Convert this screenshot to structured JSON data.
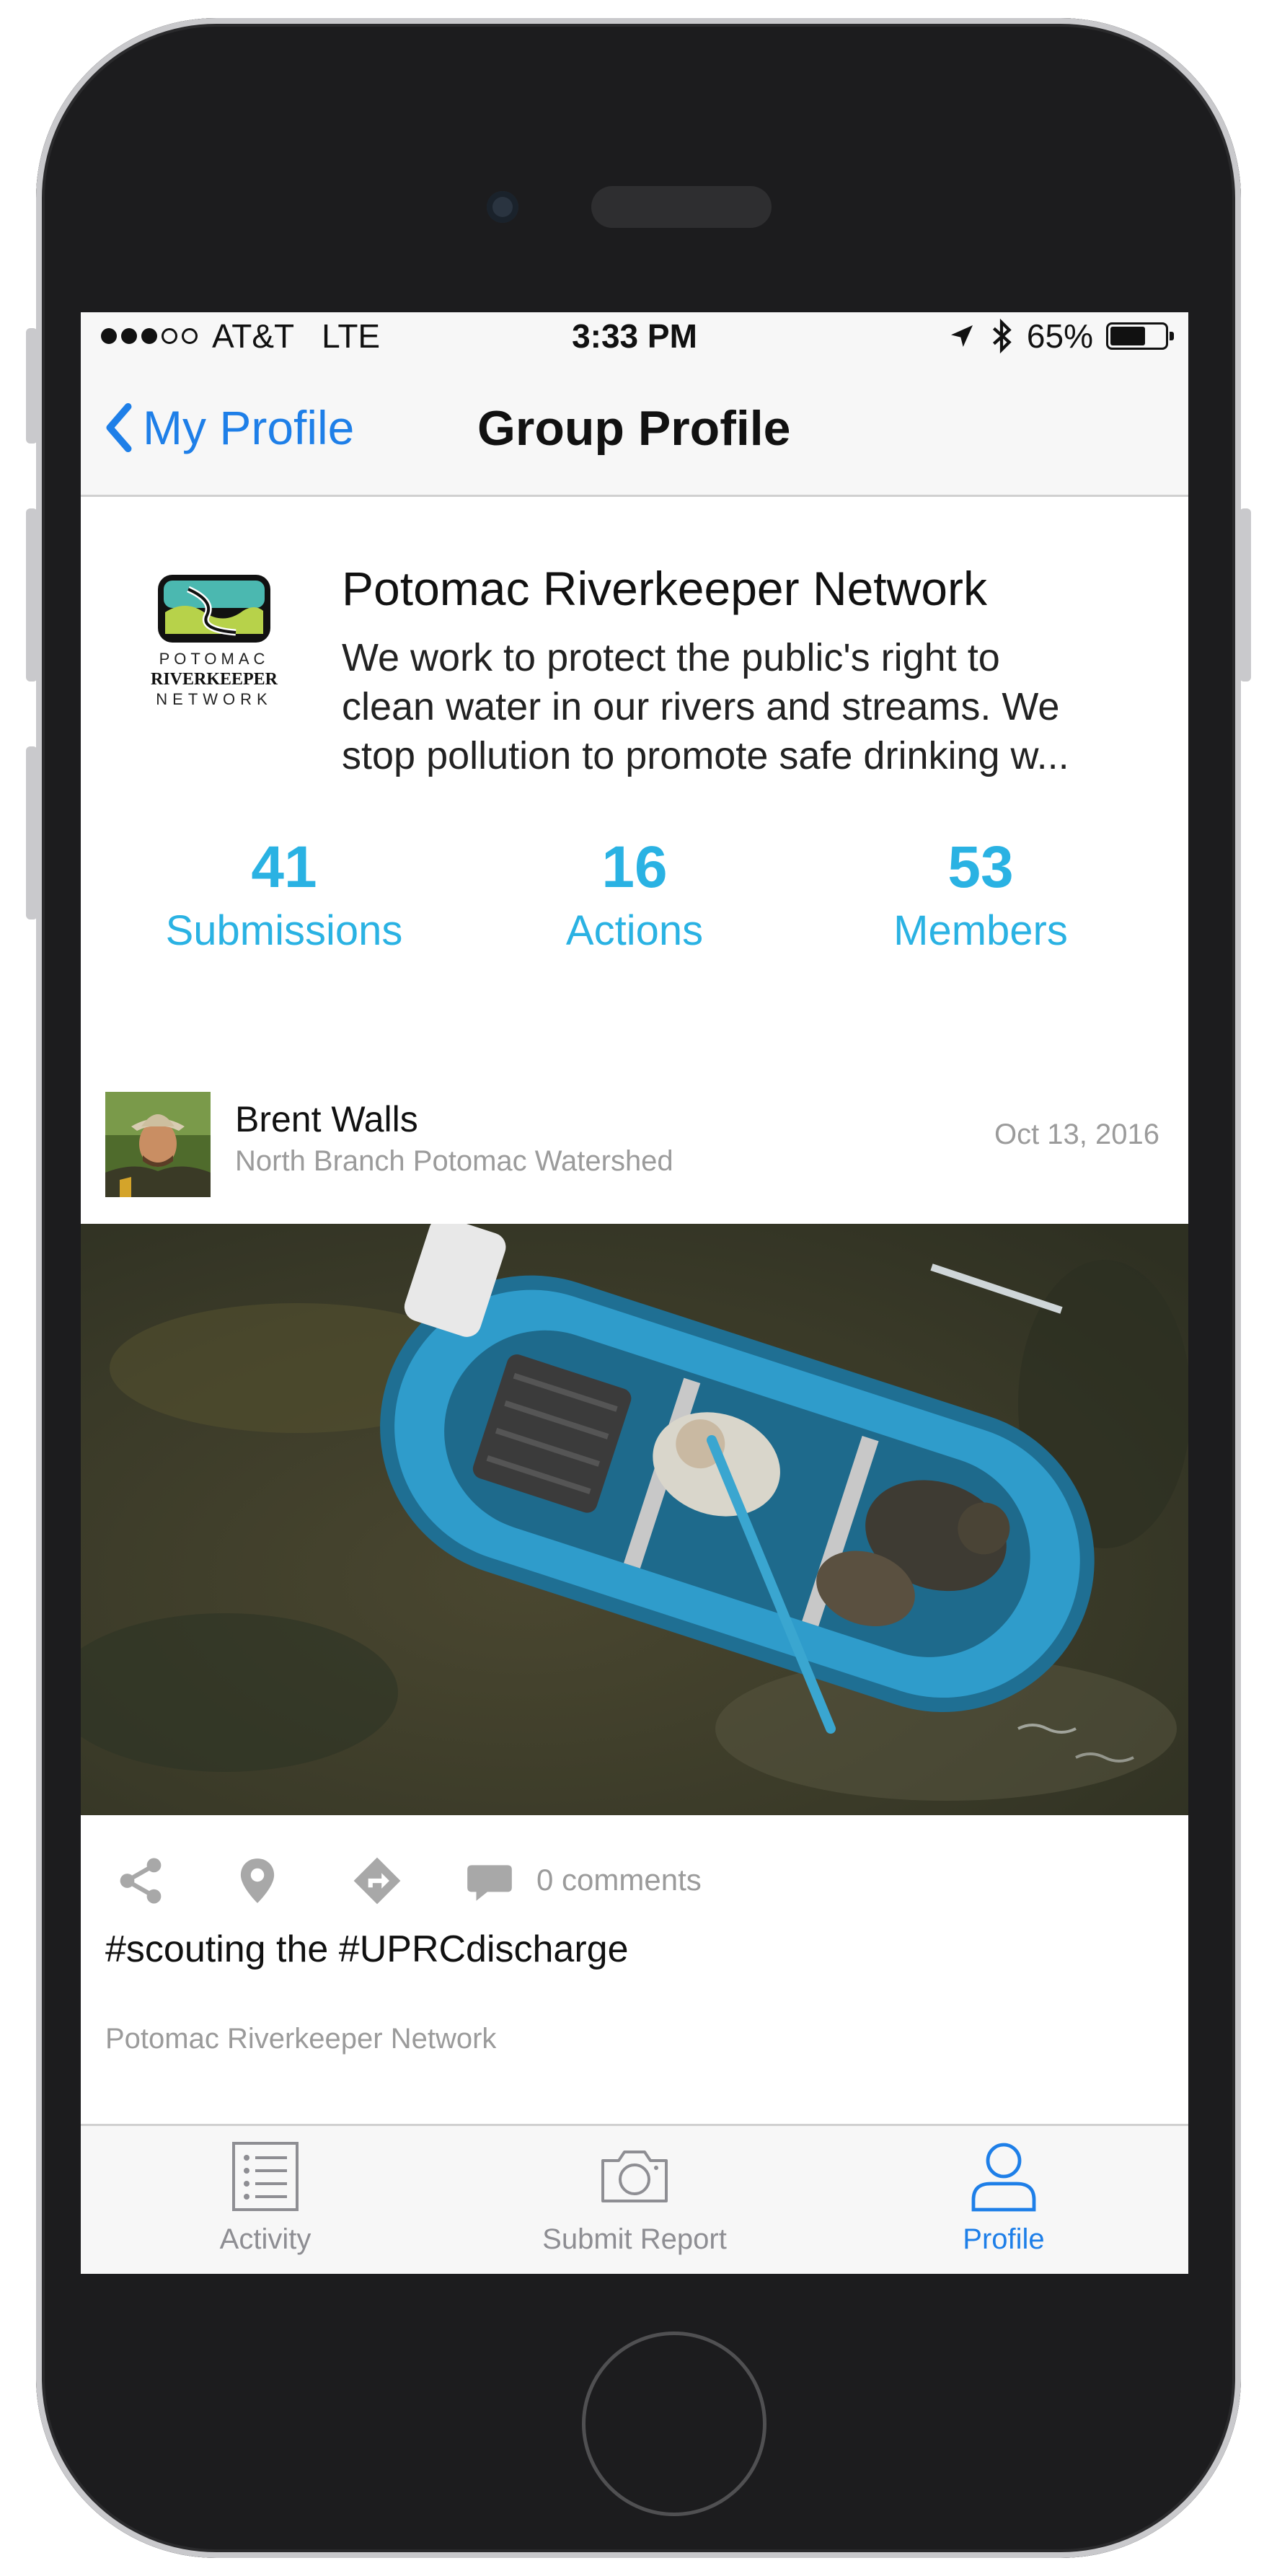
{
  "status_bar": {
    "carrier": "AT&T",
    "network": "LTE",
    "time": "3:33 PM",
    "battery_percent_label": "65%",
    "battery_level": 0.65,
    "signal_bars_filled": 3,
    "signal_bars_total": 5,
    "icons": [
      "location-arrow-icon",
      "bluetooth-icon",
      "battery-icon"
    ]
  },
  "nav": {
    "back_label": "My Profile",
    "title": "Group Profile"
  },
  "group": {
    "logo_text": [
      "POTOMAC",
      "RIVERKEEPER",
      "NETWORK"
    ],
    "name": "Potomac Riverkeeper Network",
    "description_lines": [
      "We work to protect the public's right to",
      "clean water in our rivers and streams. We",
      "stop pollution to promote safe drinking w..."
    ],
    "stats": [
      {
        "value": "41",
        "label": "Submissions"
      },
      {
        "value": "16",
        "label": "Actions"
      },
      {
        "value": "53",
        "label": "Members"
      }
    ]
  },
  "post": {
    "author": "Brent Walls",
    "author_group": "North Branch Potomac Watershed",
    "date": "Oct 13, 2016",
    "comments_label": "0 comments",
    "caption": "#scouting the #UPRCdischarge",
    "group_name": "Potomac Riverkeeper Network",
    "action_icons": [
      "share-icon",
      "map-pin-icon",
      "directions-icon",
      "comment-icon"
    ]
  },
  "tabs": [
    {
      "label": "Activity",
      "icon": "activity-list-icon",
      "active": false
    },
    {
      "label": "Submit Report",
      "icon": "camera-icon",
      "active": false
    },
    {
      "label": "Profile",
      "icon": "profile-icon",
      "active": true
    }
  ],
  "colors": {
    "accent_blue": "#1e7fe8",
    "stat_cyan": "#2ab2e3",
    "muted_gray": "#9b9b9b",
    "phone_body": "#1c1c1e"
  }
}
